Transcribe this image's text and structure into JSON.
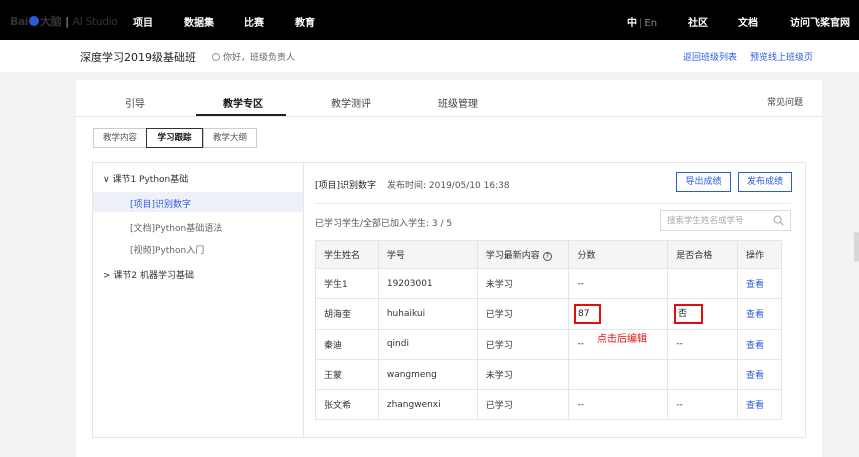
{
  "topnav": {
    "brand": "Bai",
    "brand_cn": "大脑",
    "studio": "AI Studio",
    "items": [
      "项目",
      "数据集",
      "比赛",
      "教育"
    ],
    "lang_zh": "中",
    "lang_en": "En",
    "right_items": [
      "社区",
      "文档",
      "访问飞桨官网"
    ]
  },
  "header": {
    "class_title": "深度学习2019级基础班",
    "greeting": "你好，班级负责人",
    "links": [
      "返回班级列表",
      "预览线上班级页"
    ]
  },
  "tabs": [
    "引导",
    "教学专区",
    "教学测评",
    "班级管理"
  ],
  "active_tab": "教学专区",
  "faq": "常见问题",
  "subtabs": [
    "教学内容",
    "学习跟踪",
    "教学大纲"
  ],
  "active_subtab": "学习跟踪",
  "sidebar": {
    "section1": "课节1 Python基础",
    "items": [
      "[项目]识别数字",
      "[文档]Python基础语法",
      "[视频]Python入门"
    ],
    "section2": "课节2 机器学习基础"
  },
  "panel": {
    "title": "[项目]识别数字",
    "publish_time": "发布时间: 2019/05/10 16:38",
    "export_btn": "导出成绩",
    "publish_btn": "发布成绩",
    "stat": "已学习学生/全部已加入学生: 3 / 5",
    "search_placeholder": "搜索学生姓名或学号"
  },
  "table": {
    "headers": [
      "学生姓名",
      "学号",
      "学习最新内容",
      "分数",
      "是否合格",
      "操作"
    ],
    "rows": [
      {
        "name": "学生1",
        "id": "19203001",
        "status": "未学习",
        "score": "--",
        "pass": "",
        "action": "查看"
      },
      {
        "name": "胡海奎",
        "id": "huhaikui",
        "status": "已学习",
        "score": "87",
        "pass": "否",
        "action": "查看"
      },
      {
        "name": "秦迪",
        "id": "qindi",
        "status": "已学习",
        "score": "--",
        "pass": "--",
        "action": "查看"
      },
      {
        "name": "王蒙",
        "id": "wangmeng",
        "status": "未学习",
        "score": "",
        "pass": "",
        "action": "查看"
      },
      {
        "name": "张文希",
        "id": "zhangwenxi",
        "status": "已学习",
        "score": "--",
        "pass": "--",
        "action": "查看"
      }
    ]
  },
  "annotation": "点击后编辑",
  "colors": {
    "accent": "#2a5bd7",
    "highlight": "#e01010",
    "topbar": "#000000"
  }
}
